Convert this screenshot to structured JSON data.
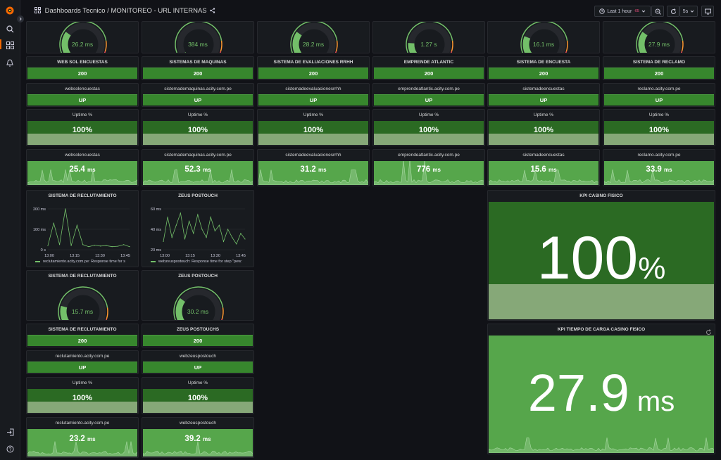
{
  "header": {
    "breadcrumb": "Dashboards Tecnico",
    "title": "/ MONITOREO - URL INTERNAS",
    "time_range": "Last 1 hour",
    "time_badge": "-05",
    "refresh": "5s"
  },
  "top_gauges": [
    {
      "value": "26.2 ms",
      "level": 0.3
    },
    {
      "value": "384 ms",
      "level": 0.05
    },
    {
      "value": "28.2 ms",
      "level": 0.3
    },
    {
      "value": "1.27 s",
      "level": 0.18
    },
    {
      "value": "16.1 ms",
      "level": 0.25
    },
    {
      "value": "27.9 ms",
      "level": 0.3
    }
  ],
  "status_row": [
    {
      "title": "WEB SOL ENCUESTAS",
      "value": "200"
    },
    {
      "title": "SISTEMAS DE MAQUINAS",
      "value": "200"
    },
    {
      "title": "SISTEMA DE EVALUACIONES RRHH",
      "value": "200"
    },
    {
      "title": "EMPRENDE ATLANTIC",
      "value": "200"
    },
    {
      "title": "SISTEMA DE ENCUESTA",
      "value": "200"
    },
    {
      "title": "SISTEMA DE RECLAMO",
      "value": "200"
    }
  ],
  "up_row": [
    {
      "title": "websolencuestas",
      "value": "UP"
    },
    {
      "title": "sistemademaquinas.acity.com.pe",
      "value": "UP"
    },
    {
      "title": "sistemadeevaluacionesrrhh",
      "value": "UP"
    },
    {
      "title": "emprendeatlantic.acity.com.pe",
      "value": "UP"
    },
    {
      "title": "sistemadeencuestas",
      "value": "UP"
    },
    {
      "title": "reclamo.acity.com.pe",
      "value": "UP"
    }
  ],
  "uptime_row": [
    {
      "title": "Uptime %",
      "value": "100%"
    },
    {
      "title": "Uptime %",
      "value": "100%"
    },
    {
      "title": "Uptime %",
      "value": "100%"
    },
    {
      "title": "Uptime %",
      "value": "100%"
    },
    {
      "title": "Uptime %",
      "value": "100%"
    },
    {
      "title": "Uptime %",
      "value": "100%"
    }
  ],
  "resp_row": [
    {
      "title": "websolencuestas",
      "value": "25.4",
      "unit": "ms"
    },
    {
      "title": "sistemademaquinas.acity.com.pe",
      "value": "52.3",
      "unit": "ms"
    },
    {
      "title": "sistemadeevaluacionesrrhh",
      "value": "31.2",
      "unit": "ms"
    },
    {
      "title": "emprendeatlantic.acity.com.pe",
      "value": "776",
      "unit": "ms"
    },
    {
      "title": "sistemadeencuestas",
      "value": "15.6",
      "unit": "ms"
    },
    {
      "title": "reclamo.acity.com.pe",
      "value": "33.9",
      "unit": "ms"
    }
  ],
  "charts": {
    "reclutamiento": {
      "title": "SISTEMA DE RECLUTAMIENTO",
      "legend": "reclutamiento.acity.com.pe: Response time for s",
      "yticks": [
        "200 ms",
        "100 ms",
        "0 s"
      ],
      "xticks": [
        "13:00",
        "13:15",
        "13:30",
        "13:45"
      ]
    },
    "zeus": {
      "title": "ZEUS POSTOUCH",
      "legend": "webzeuspostouch: Response time for step \"pew:",
      "yticks": [
        "60 ms",
        "40 ms",
        "20 ms"
      ],
      "xticks": [
        "13:00",
        "13:15",
        "13:30",
        "13:45"
      ]
    }
  },
  "chart_data": [
    {
      "type": "line",
      "title": "SISTEMA DE RECLUTAMIENTO",
      "x": [
        "13:00",
        "13:15",
        "13:30",
        "13:45"
      ],
      "ylim": [
        0,
        200
      ],
      "series": [
        {
          "name": "reclutamiento.acity.com.pe: Response time for s",
          "values": [
            20,
            130,
            25,
            210,
            20,
            120,
            25,
            15,
            22,
            18,
            20,
            15,
            17,
            25,
            15
          ]
        }
      ]
    },
    {
      "type": "line",
      "title": "ZEUS POSTOUCH",
      "x": [
        "13:00",
        "13:15",
        "13:30",
        "13:45"
      ],
      "ylim": [
        15,
        65
      ],
      "series": [
        {
          "name": "webzeuspostouch: Response time for step \"pew:",
          "values": [
            25,
            55,
            30,
            45,
            60,
            28,
            50,
            35,
            58,
            40,
            30,
            55,
            38,
            45,
            25,
            40,
            30,
            22,
            35,
            28
          ]
        }
      ]
    }
  ],
  "mid_gauges": [
    {
      "title": "SISTEMA DE RECLUTAMIENTO",
      "value": "15.7 ms",
      "level": 0.22
    },
    {
      "title": "ZEUS POSTOUCH",
      "value": "30.2 ms",
      "level": 0.3
    }
  ],
  "bottom_status": [
    {
      "title": "SISTEMA DE RECLUTAMIENTO",
      "value": "200"
    },
    {
      "title": "ZEUS POSTOUCHS",
      "value": "200"
    }
  ],
  "bottom_up": [
    {
      "title": "reclutamiento.acity.com.pe",
      "value": "UP"
    },
    {
      "title": "webzeuspostouch",
      "value": "UP"
    }
  ],
  "bottom_uptime": [
    {
      "title": "Uptime %",
      "value": "100%"
    },
    {
      "title": "Uptime %",
      "value": "100%"
    }
  ],
  "bottom_resp": [
    {
      "title": "reclutamiento.acity.com.pe",
      "value": "23.2",
      "unit": "ms"
    },
    {
      "title": "webzeuspostouch",
      "value": "39.2",
      "unit": "ms"
    }
  ],
  "kpi_casino": {
    "title": "KPI CASINO FISICO",
    "value": "100",
    "unit": "%"
  },
  "kpi_carga": {
    "title": "KPI TIEMPO DE CARGA CASINO FISICO",
    "value": "27.9",
    "unit": "ms"
  },
  "colors": {
    "green": "#56a64b",
    "dark_green": "#37872d",
    "bg": "#111217",
    "panel": "#181b1f",
    "red": "#f2495c",
    "orange": "#ff9830"
  }
}
